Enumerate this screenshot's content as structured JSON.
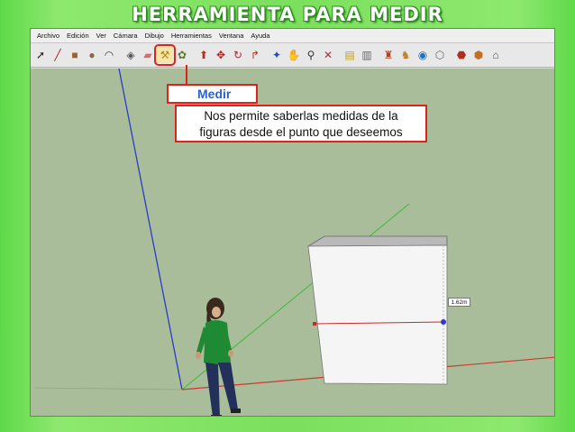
{
  "slide": {
    "title": "HERRAMIENTA PARA MEDIR"
  },
  "menu": [
    "Archivo",
    "Edición",
    "Ver",
    "Cámara",
    "Dibujo",
    "Herramientas",
    "Ventana",
    "Ayuda"
  ],
  "toolbar": {
    "tools": [
      {
        "name": "select-tool",
        "glyph": "➚",
        "color": "#222222"
      },
      {
        "name": "line-tool",
        "glyph": "╱",
        "color": "#b02020"
      },
      {
        "name": "rectangle-tool",
        "glyph": "■",
        "color": "#a0602a"
      },
      {
        "name": "circle-tool",
        "glyph": "●",
        "color": "#8a6a3c"
      },
      {
        "name": "arc-tool",
        "glyph": "◠",
        "color": "#444444"
      },
      {
        "name": "sep"
      },
      {
        "name": "make-component-tool",
        "glyph": "◈",
        "color": "#555555"
      },
      {
        "name": "eraser-tool",
        "glyph": "▰",
        "color": "#d07070"
      },
      {
        "name": "tape-measure-tool",
        "glyph": "⚒",
        "color": "#b08a20",
        "active": true
      },
      {
        "name": "paint-bucket-tool",
        "glyph": "✿",
        "color": "#5a7a30"
      },
      {
        "name": "sep"
      },
      {
        "name": "push-pull-tool",
        "glyph": "⬆",
        "color": "#b03020"
      },
      {
        "name": "move-tool",
        "glyph": "✥",
        "color": "#b02020"
      },
      {
        "name": "rotate-tool",
        "glyph": "↻",
        "color": "#c02020"
      },
      {
        "name": "follow-me-tool",
        "glyph": "↱",
        "color": "#b03020"
      },
      {
        "name": "sep"
      },
      {
        "name": "orbit-tool",
        "glyph": "✦",
        "color": "#2050b0"
      },
      {
        "name": "pan-tool",
        "glyph": "✋",
        "color": "#333333"
      },
      {
        "name": "zoom-tool",
        "glyph": "⚲",
        "color": "#333333"
      },
      {
        "name": "zoom-extents-tool",
        "glyph": "✕",
        "color": "#b03030"
      },
      {
        "name": "sep"
      },
      {
        "name": "warehouse-tool",
        "glyph": "▤",
        "color": "#c0a020"
      },
      {
        "name": "share-model-tool",
        "glyph": "▥",
        "color": "#666666"
      },
      {
        "name": "sep"
      },
      {
        "name": "components-tool",
        "glyph": "♜",
        "color": "#b04020"
      },
      {
        "name": "styles-tool",
        "glyph": "♞",
        "color": "#c08020"
      },
      {
        "name": "google-earth-tool",
        "glyph": "◉",
        "color": "#2070c0"
      },
      {
        "name": "geolocation-tool",
        "glyph": "⬡",
        "color": "#666666"
      },
      {
        "name": "sep"
      },
      {
        "name": "photo-textures-tool",
        "glyph": "⬣",
        "color": "#b03020"
      },
      {
        "name": "extension-tool",
        "glyph": "⬢",
        "color": "#c07020"
      },
      {
        "name": "layout-tool",
        "glyph": "⌂",
        "color": "#555555"
      }
    ]
  },
  "callout": {
    "tag": "Medir",
    "line1": "Nos permite saberlas medidas de la",
    "line2": "figuras desde el punto que deseemos"
  },
  "measurement": {
    "value": "1.62m"
  },
  "colors": {
    "accent": "#d9251c",
    "tag_text": "#2b63c6",
    "viewport_bg": "#a9bd9a",
    "axis_blue": "#2b3cc4",
    "axis_green": "#3dbb3a",
    "axis_red": "#cc3a2e"
  }
}
